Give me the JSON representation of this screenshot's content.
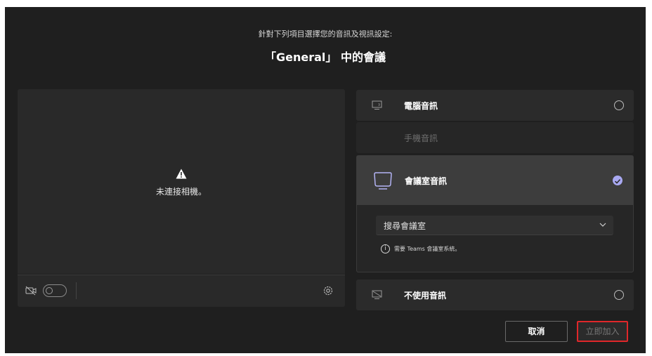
{
  "header": {
    "subtitle": "針對下列項目選擇您的音訊及視訊設定:",
    "title": "「General」 中的會議"
  },
  "preview": {
    "warning_icon": "warning-icon",
    "message": "未連接相機。",
    "camera_toggle": false
  },
  "audio_options": {
    "pc": {
      "label": "電腦音訊",
      "icon": "computer-audio-icon",
      "selected": false
    },
    "phone": {
      "label": "手機音訊",
      "enabled": false
    },
    "room": {
      "label": "會議室音訊",
      "icon": "room-device-icon",
      "selected": true,
      "search_placeholder": "搜尋會議室",
      "info": "需要 Teams 會議室系統。"
    },
    "none": {
      "label": "不使用音訊",
      "icon": "no-audio-icon",
      "selected": false
    }
  },
  "footer": {
    "cancel_label": "取消",
    "join_label": "立即加入"
  },
  "colors": {
    "accent": "#a9a9f2",
    "highlight": "#e0272a",
    "background": "#1f1f1f"
  }
}
